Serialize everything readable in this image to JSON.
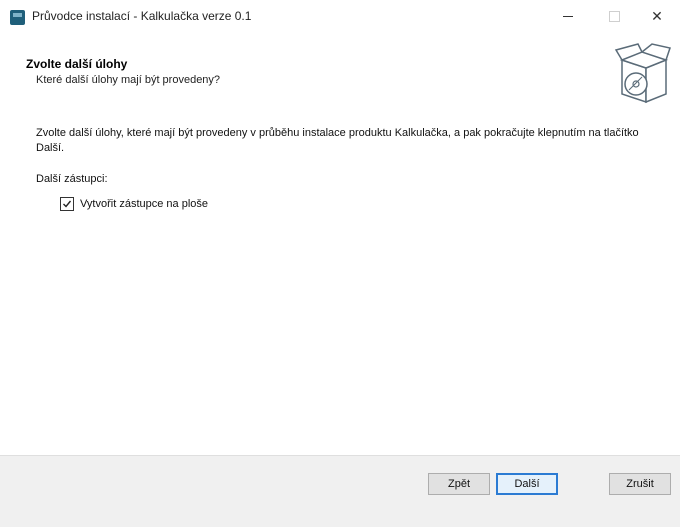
{
  "window": {
    "title": "Průvodce instalací - Kalkulačka verze 0.1",
    "close_glyph": "✕"
  },
  "header": {
    "title": "Zvolte další úlohy",
    "subtitle": "Které další úlohy mají být provedeny?",
    "graphic_icon": "setup-box-icon"
  },
  "content": {
    "description": "Zvolte další úlohy, které mají být provedeny v průběhu instalace produktu Kalkulačka, a pak pokračujte klepnutím na tlačítko Další.",
    "group_label": "Další zástupci:",
    "tasks": [
      {
        "label": "Vytvořit zástupce na ploše",
        "checked": true
      }
    ]
  },
  "footer": {
    "back_label": "Zpět",
    "next_label": "Další",
    "cancel_label": "Zrušit"
  },
  "colors": {
    "footer_bg": "#f0f0f0",
    "default_button_border": "#2b7bd3"
  }
}
